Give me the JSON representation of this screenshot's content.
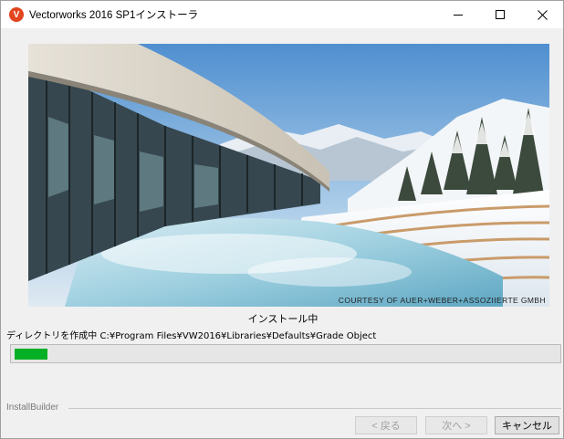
{
  "window": {
    "title": "Vectorworks 2016 SP1インストーラ",
    "app_icon_glyph": "V",
    "accent_color": "#e2461f"
  },
  "banner": {
    "credit": "COURTESY OF AUER+WEBER+ASSOZIIERTE GMBH"
  },
  "install": {
    "status": "インストール中",
    "detail": "ディレクトリを作成中 C:¥Program Files¥VW2016¥Libraries¥Defaults¥Grade Object",
    "progress": 0.06,
    "progress_color": "#06b025"
  },
  "footer": {
    "brand_label": "InstallBuilder",
    "back_label": "< 戻る",
    "next_label": "次へ >",
    "cancel_label": "キャンセル"
  }
}
